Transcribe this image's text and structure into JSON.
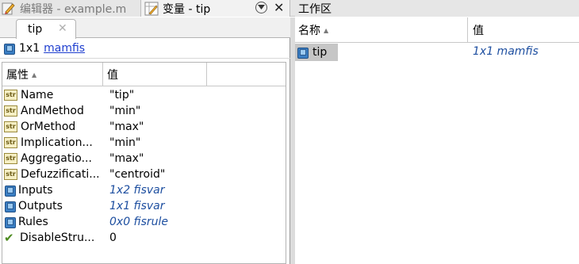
{
  "tabs": {
    "editor": "编辑器 - example.m",
    "variable": "变量 - tip",
    "workspace": "工作区"
  },
  "variable_editor": {
    "subtab_label": "tip",
    "type_size": "1x1",
    "type_class": "mamfis",
    "columns": {
      "property": "属性",
      "value": "值"
    },
    "rows": [
      {
        "icon": "str-icon",
        "name": "Name",
        "value": "\"tip\""
      },
      {
        "icon": "str-icon",
        "name": "AndMethod",
        "value": "\"min\""
      },
      {
        "icon": "str-icon",
        "name": "OrMethod",
        "value": "\"max\""
      },
      {
        "icon": "str-icon",
        "name": "Implication...",
        "value": "\"min\""
      },
      {
        "icon": "str-icon",
        "name": "Aggregatio...",
        "value": "\"max\""
      },
      {
        "icon": "str-icon",
        "name": "Defuzzificati...",
        "value": "\"centroid\""
      },
      {
        "icon": "object-icon",
        "name": "Inputs",
        "value": "1x2 fisvar"
      },
      {
        "icon": "object-icon",
        "name": "Outputs",
        "value": "1x1 fisvar"
      },
      {
        "icon": "object-icon",
        "name": "Rules",
        "value": "0x0 fisrule"
      },
      {
        "icon": "check-icon",
        "name": "DisableStru...",
        "value": "0"
      }
    ]
  },
  "workspace": {
    "columns": {
      "name": "名称",
      "value": "值"
    },
    "variables": [
      {
        "name": "tip",
        "value": "1x1 mamfis"
      }
    ]
  },
  "colors": {
    "link": "#1e3ecf",
    "object_value": "#1e4fa0",
    "selected_row": "#c6c6c6"
  }
}
